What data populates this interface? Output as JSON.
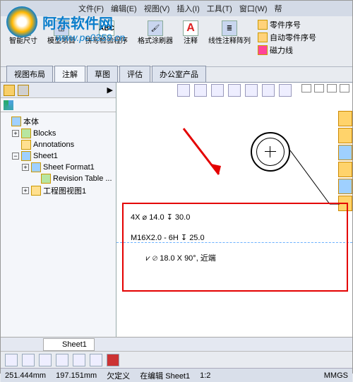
{
  "watermark": {
    "text": "阿东软件网",
    "url": "www.pc0359.cn"
  },
  "menu": {
    "file": "文件(F)",
    "edit": "编辑(E)",
    "view": "视图(V)",
    "insert": "插入(I)",
    "tools": "工具(T)",
    "window": "窗口(W)",
    "help": "帮"
  },
  "ribbon": {
    "smartdim": "智能尺寸",
    "modelitems": "模型项目",
    "spellcheck": "拼写检验程序",
    "fmtpaint": "格式涂刷器",
    "annot": "注释",
    "lineannot": "线性注释阵列",
    "partnum": "零件序号",
    "autopart": "自动零件序号",
    "magline": "磁力线"
  },
  "tabs": {
    "layout": "视图布局",
    "annot": "注解",
    "sketch": "草图",
    "eval": "评估",
    "office": "办公室产品"
  },
  "tree": {
    "root": "本体",
    "blocks": "Blocks",
    "annots": "Annotations",
    "sheet": "Sheet1",
    "sheetfmt": "Sheet Format1",
    "revtbl": "Revision Table",
    "revsuffix": "...",
    "view1": "工程图视图1"
  },
  "callout": {
    "l1": "4X ⌀ 14.0 ↧ 30.0",
    "l2": "M16X2.0 - 6H ↧ 25.0",
    "l3": "⩗ ⌀ 18.0 X 90°, 近端"
  },
  "sheettab": {
    "label": "Sheet1"
  },
  "status": {
    "x": "251.444mm",
    "y": "197.151mm",
    "under": "欠定义",
    "editing": "在编辑 Sheet1",
    "scale": "1:2",
    "mmgs": "MMGS"
  }
}
